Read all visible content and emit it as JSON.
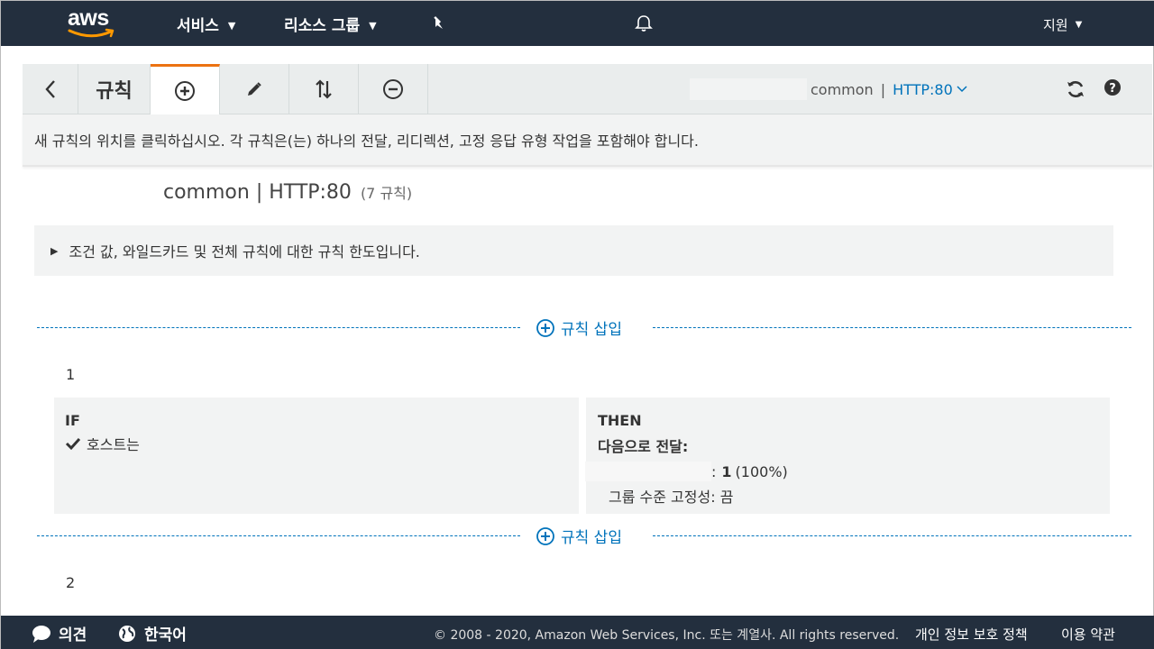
{
  "nav": {
    "logo": "aws",
    "services": "서비스",
    "resource_groups": "리소스 그룹",
    "support": "지원",
    "icons": [
      "pin-icon",
      "bell-icon",
      "chevron-down-icon"
    ]
  },
  "toolbar": {
    "title": "규칙",
    "context_name": "common",
    "context_sep": "|",
    "listener": "HTTP:80",
    "icons": [
      "chevron-left-icon",
      "plus-circle-icon",
      "pencil-icon",
      "reorder-icon",
      "minus-circle-icon",
      "refresh-icon",
      "help-icon"
    ]
  },
  "instruction": "새 규칙의 위치를 클릭하십시오. 각 규칙은(는) 하나의 전달, 리디렉션, 고정 응답 유형 작업을 포함해야 합니다.",
  "ruleset": {
    "name": "common | HTTP:80",
    "count": "(7 규칙)"
  },
  "limits": {
    "text": "조건 값, 와일드카드 및 전체 규칙에 대한 규칙 한도입니다."
  },
  "insert_label": "규칙 삽입",
  "rules": [
    {
      "number": "1",
      "if_label": "IF",
      "condition": "호스트는",
      "then_label": "THEN",
      "action": "다음으로 전달:",
      "target_suffix": ":",
      "weight": "1",
      "weight_pct": "(100%)",
      "stickiness": "그룹 수준 고정성: 끔"
    },
    {
      "number": "2"
    }
  ],
  "footer": {
    "feedback": "의견",
    "language": "한국어",
    "copyright": "© 2008 - 2020, Amazon Web Services, Inc. 또는 계열사. All rights reserved.",
    "privacy": "개인 정보 보호 정책",
    "terms": "이용 약관"
  },
  "colors": {
    "nav_bg": "#232f3e",
    "accent": "#ec7211",
    "link": "#0073bb",
    "panel": "#f2f3f3"
  }
}
